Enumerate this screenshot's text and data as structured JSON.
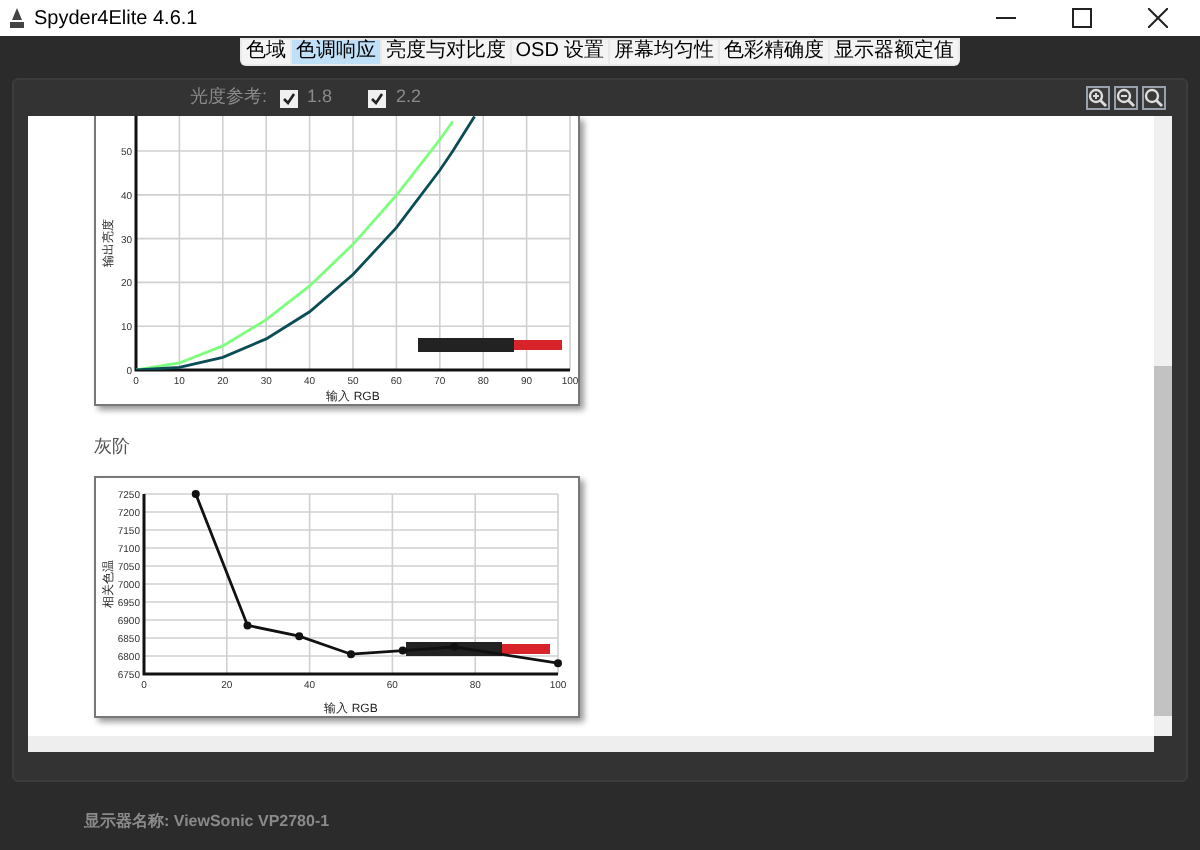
{
  "window": {
    "title": "Spyder4Elite 4.6.1"
  },
  "tabs": [
    {
      "label": "色域",
      "selected": false
    },
    {
      "label": "色调响应",
      "selected": true
    },
    {
      "label": "亮度与对比度",
      "selected": false
    },
    {
      "label": "OSD 设置",
      "selected": false
    },
    {
      "label": "屏幕均匀性",
      "selected": false
    },
    {
      "label": "色彩精确度",
      "selected": false
    },
    {
      "label": "显示器额定值",
      "selected": false
    }
  ],
  "toolbar": {
    "label": "光度参考:",
    "options": [
      {
        "label": "1.8",
        "checked": true
      },
      {
        "label": "2.2",
        "checked": true
      }
    ]
  },
  "charts": [
    {
      "chart_data": {
        "type": "line",
        "xlabel": "输入 RGB",
        "ylabel": "输出亮度",
        "x": [
          0,
          10,
          20,
          30,
          40,
          50,
          60,
          70,
          73,
          78
        ],
        "xlim": [
          0,
          100
        ],
        "ylim": [
          0,
          58
        ],
        "grid": true,
        "xticks": [
          0,
          10,
          20,
          30,
          40,
          50,
          60,
          70,
          80,
          90,
          100
        ],
        "yticks": [
          0,
          10,
          20,
          30,
          40,
          50
        ],
        "series": [
          {
            "color": "#7cff7c",
            "values": [
              0,
              1.6,
              5.5,
              11.5,
              19.2,
              28.7,
              39.9,
              52.6,
              56.8,
              null
            ]
          },
          {
            "color": "#0b4d55",
            "values": [
              0,
              0.6,
              2.9,
              7.1,
              13.3,
              21.8,
              32.5,
              45.6,
              50.0,
              57.9
            ]
          }
        ]
      }
    },
    {
      "title": "灰阶",
      "chart_data": {
        "type": "line",
        "xlabel": "输入 RGB",
        "ylabel": "相关色温",
        "x": [
          12.5,
          25,
          37.5,
          50,
          62.5,
          75,
          100
        ],
        "xlim": [
          0,
          100
        ],
        "ylim": [
          6750,
          7250
        ],
        "grid": true,
        "xticks": [
          0,
          20,
          40,
          60,
          80,
          100
        ],
        "yticks": [
          6750,
          6800,
          6850,
          6900,
          6950,
          7000,
          7050,
          7100,
          7150,
          7200,
          7250
        ],
        "series": [
          {
            "color": "#111111",
            "marker": true,
            "values": [
              7250,
              6885,
              6855,
              6805,
              6815,
              6825,
              6780
            ]
          }
        ]
      }
    }
  ],
  "footer": {
    "text": "显示器名称: ViewSonic VP2780-1"
  }
}
